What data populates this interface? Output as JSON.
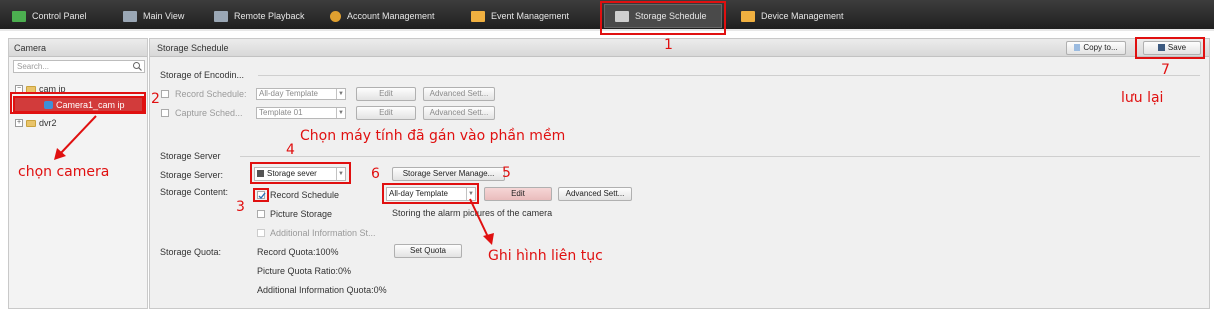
{
  "nav_tabs": [
    {
      "label": "Control Panel",
      "color": "#4caf50"
    },
    {
      "label": "Main View",
      "color": "#9aa7b5"
    },
    {
      "label": "Remote Playback",
      "color": "#9aa7b5"
    },
    {
      "label": "Account Management",
      "color": "#e0a030"
    },
    {
      "label": "Event Management",
      "color": "#f0b040"
    },
    {
      "label": "Storage Schedule",
      "color": "#cfcfcf"
    },
    {
      "label": "Device Management",
      "color": "#f0b040"
    }
  ],
  "camera_panel": {
    "title": "Camera",
    "search_placeholder": "Search...",
    "tree": [
      {
        "label": "cam ip",
        "expander": "−"
      },
      {
        "label": "Camera1_cam ip"
      },
      {
        "label": "dvr2",
        "expander": "+"
      }
    ]
  },
  "storage": {
    "title": "Storage Schedule",
    "copy_to_label": "Copy to...",
    "save_label": "Save",
    "encoding_section": "Storage of Encodin...",
    "record_schedule_label": "Record Schedule:",
    "record_template_value": "All-day Template",
    "capture_schedule_label": "Capture Sched...",
    "capture_template_value": "Template 01",
    "edit_label": "Edit",
    "advanced_label": "Advanced Sett...",
    "server_section": "Storage Server",
    "server_label": "Storage Server:",
    "server_value": "Storage sever",
    "server_manage_label": "Storage Server Manage...",
    "content_label": "Storage Content:",
    "content_record": "Record Schedule",
    "content_picture": "Picture Storage",
    "content_additional": "Additional Information St...",
    "content_template_value": "All-day Template",
    "alarm_note": "Storing the alarm pictures of the camera",
    "quota_label": "Storage Quota:",
    "record_quota": "Record Quota:100%",
    "picture_quota": "Picture Quota Ratio:0%",
    "additional_quota": "Additional Information Quota:0%",
    "set_quota_label": "Set Quota"
  },
  "annotations": {
    "n1": "1",
    "n2": "2",
    "n3": "3",
    "n4": "4",
    "n5": "5",
    "n6": "6",
    "n7": "7",
    "choose_computer": "Chọn máy tính đã gán vào phần mềm",
    "choose_camera": "chọn camera",
    "save_note": "lưu lại",
    "continuous": "Ghi hình liên tục",
    "color": "#e01010"
  }
}
